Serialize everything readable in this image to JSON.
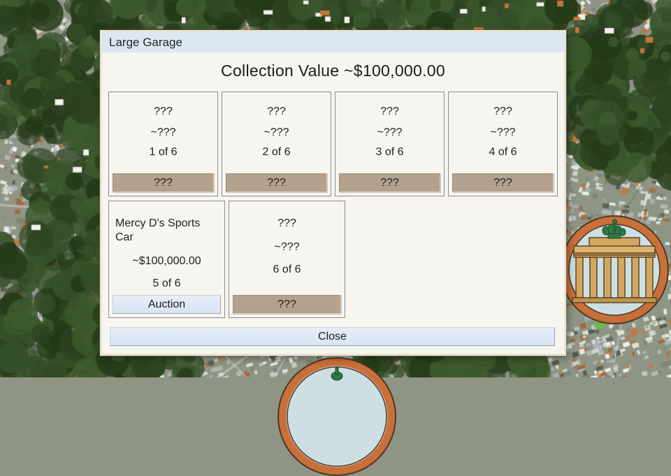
{
  "window": {
    "title": "Large Garage"
  },
  "dialog": {
    "heading": "Collection Value ~$100,000.00",
    "close_label": "Close"
  },
  "cars": [
    {
      "name": "???",
      "value": "~???",
      "position": "1 of 6",
      "button": "???"
    },
    {
      "name": "???",
      "value": "~???",
      "position": "2 of 6",
      "button": "???"
    },
    {
      "name": "???",
      "value": "~???",
      "position": "3 of 6",
      "button": "???"
    },
    {
      "name": "???",
      "value": "~???",
      "position": "4 of 6",
      "button": "???"
    },
    {
      "name": "Mercy D's Sports Car",
      "value": "~$100,000.00",
      "position": "5 of 6",
      "button": "Auction"
    },
    {
      "name": "???",
      "value": "~???",
      "position": "6 of 6",
      "button": "???"
    }
  ],
  "icons": {
    "right_medallion": "brandenburg-gate",
    "bottom_medallion": "landmark-ring"
  },
  "colors": {
    "titlebar": "#dce8f4",
    "dialog_body": "#f6f5f0",
    "tan_button": "#b3a28e",
    "blue_button": "#dde9f5",
    "medallion_ring": "#c96f38",
    "medallion_fill": "#cddfe3",
    "map_forest": "#2c421f"
  }
}
